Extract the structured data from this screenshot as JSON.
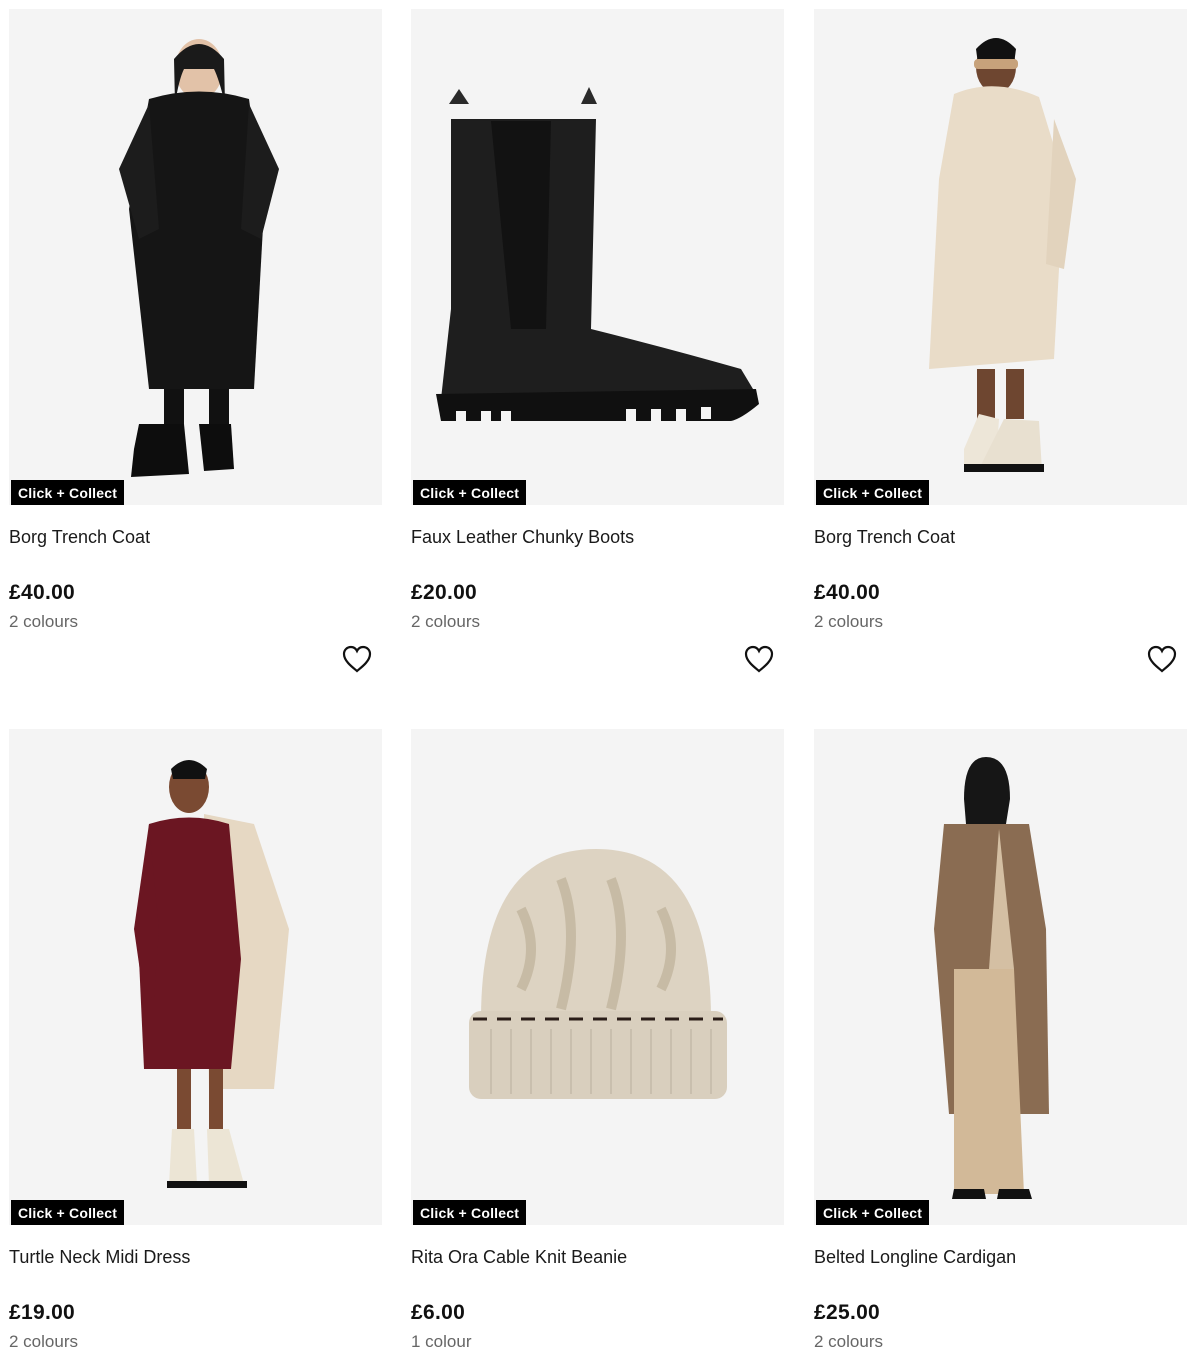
{
  "products": [
    {
      "name": "Borg Trench Coat",
      "price": "£40.00",
      "colours": "2 colours",
      "badge": "Click + Collect",
      "has_wishlist": true,
      "image": "black-borg-coat-model"
    },
    {
      "name": "Faux Leather Chunky Boots",
      "price": "£20.00",
      "colours": "2 colours",
      "badge": "Click + Collect",
      "has_wishlist": true,
      "image": "black-chelsea-boot"
    },
    {
      "name": "Borg Trench Coat",
      "price": "£40.00",
      "colours": "2 colours",
      "badge": "Click + Collect",
      "has_wishlist": true,
      "image": "cream-borg-coat-model"
    },
    {
      "name": "Turtle Neck Midi Dress",
      "price": "£19.00",
      "colours": "2 colours",
      "badge": "Click + Collect",
      "has_wishlist": false,
      "image": "burgundy-dress-model"
    },
    {
      "name": "Rita Ora Cable Knit Beanie",
      "price": "£6.00",
      "colours": "1 colour",
      "badge": "Click + Collect",
      "has_wishlist": false,
      "image": "cable-knit-beanie"
    },
    {
      "name": "Belted Longline Cardigan",
      "price": "£25.00",
      "colours": "2 colours",
      "badge": "Click + Collect",
      "has_wishlist": false,
      "image": "brown-cardigan-model"
    }
  ],
  "colors": {
    "badge_bg": "#000000",
    "badge_text": "#ffffff",
    "image_bg": "#f3f3f3",
    "secondary_text": "#666666"
  }
}
